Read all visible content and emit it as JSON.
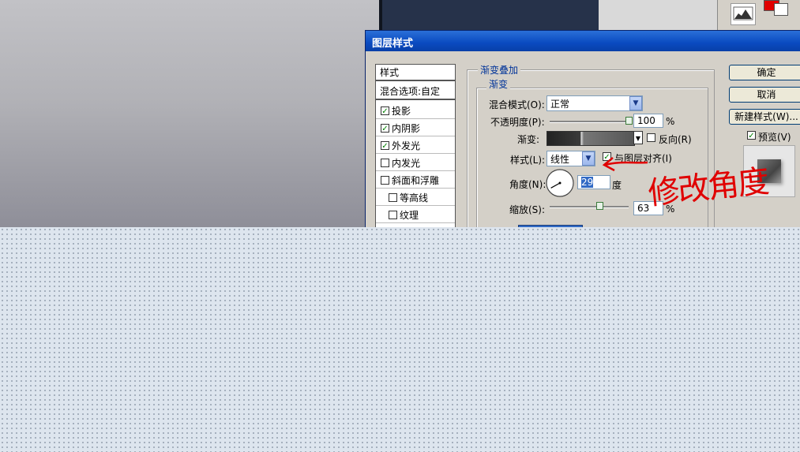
{
  "dialog": {
    "title": "图层样式"
  },
  "style_list": {
    "header": "样式",
    "blend_options": "混合选项:自定",
    "items": [
      {
        "label": "投影",
        "checked": true,
        "indent": false
      },
      {
        "label": "内阴影",
        "checked": true,
        "indent": false
      },
      {
        "label": "外发光",
        "checked": true,
        "indent": false
      },
      {
        "label": "内发光",
        "checked": false,
        "indent": false
      },
      {
        "label": "斜面和浮雕",
        "checked": false,
        "indent": false
      },
      {
        "label": "等高线",
        "checked": false,
        "indent": true
      },
      {
        "label": "纹理",
        "checked": false,
        "indent": true
      }
    ]
  },
  "gradient_overlay": {
    "group_title": "渐变叠加",
    "sub_title": "渐变",
    "blend_mode_label": "混合模式(O):",
    "blend_mode_value": "正常",
    "opacity_label": "不透明度(P):",
    "opacity_value": "100",
    "opacity_unit": "%",
    "opacity_level": 1.0,
    "gradient_label": "渐变:",
    "reverse_label": "反向(R)",
    "reverse_checked": false,
    "style_label": "样式(L):",
    "style_value": "线性",
    "align_label": "与图层对齐(I)",
    "align_checked": true,
    "angle_label": "角度(N):",
    "angle_value": "29",
    "angle_unit": "度",
    "scale_label": "缩放(S):",
    "scale_value": "63",
    "scale_unit": "%",
    "scale_level": 0.63
  },
  "buttons": {
    "ok": "确定",
    "cancel": "取消",
    "new_style": "新建样式(W)...",
    "preview": "预览(V)",
    "preview_checked": true
  },
  "annotation": {
    "text": "修改角度",
    "color": "#e00000"
  },
  "colors": {
    "title_bar": "#0a4ac0",
    "foreground_swatch": "#e00000"
  }
}
